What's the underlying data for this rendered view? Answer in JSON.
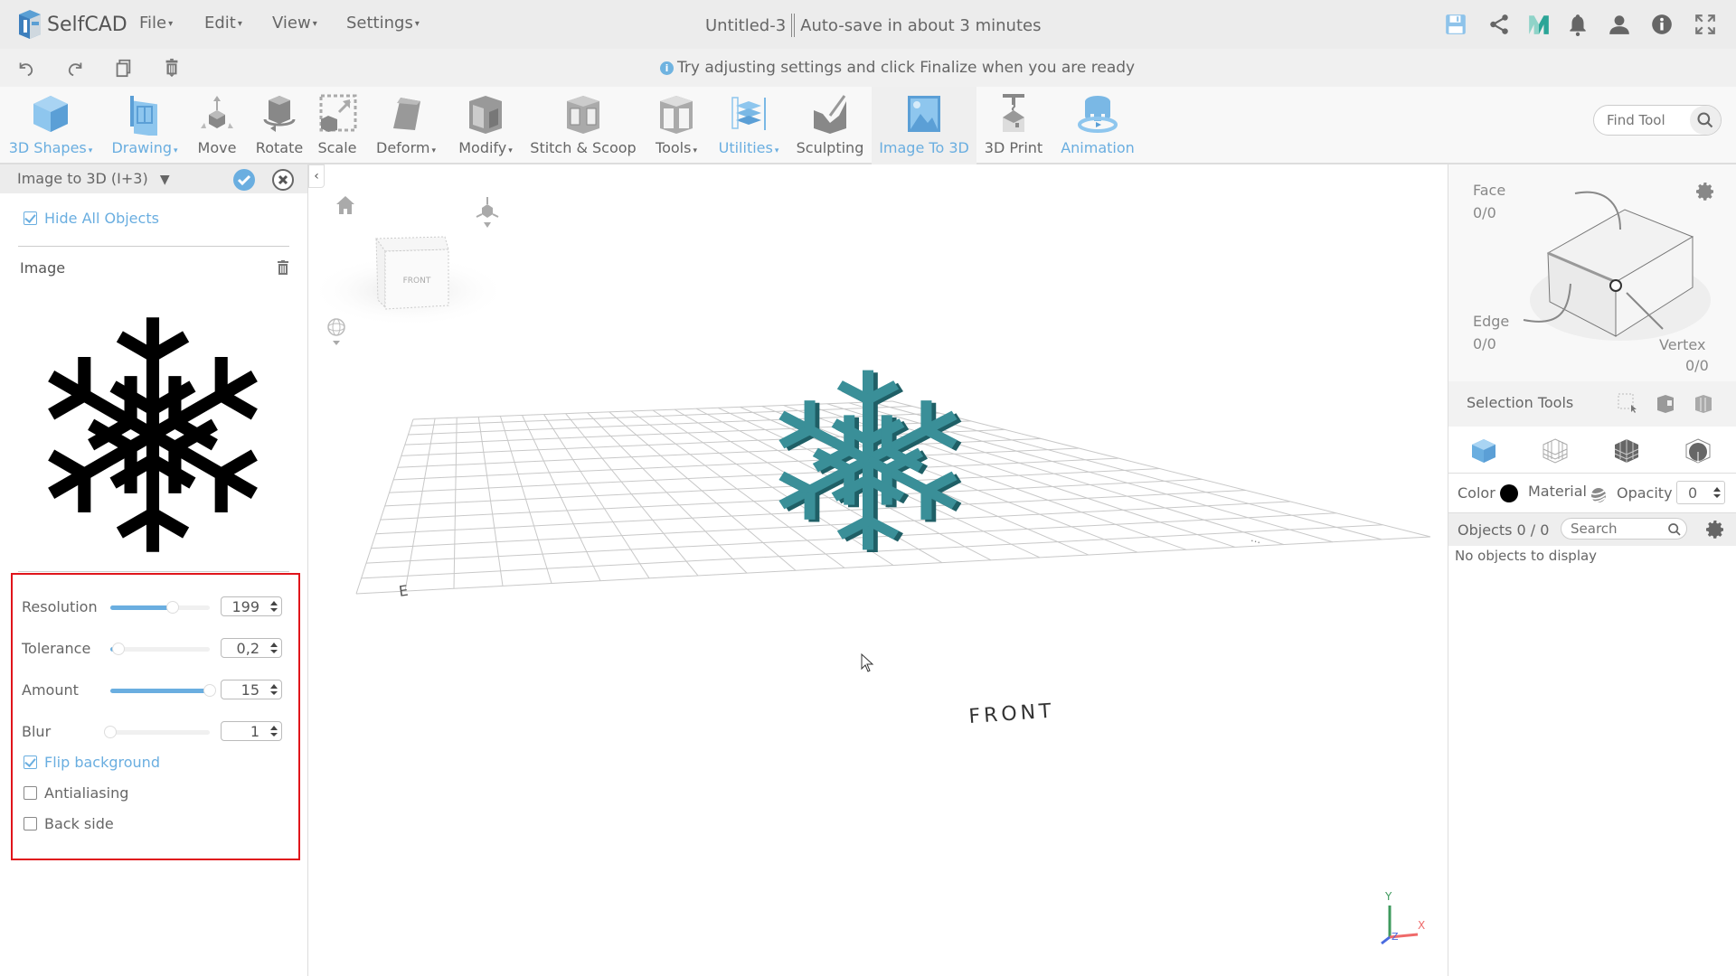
{
  "app": {
    "name": "SelfCAD"
  },
  "menu": [
    {
      "label": "File"
    },
    {
      "label": "Edit"
    },
    {
      "label": "View"
    },
    {
      "label": "Settings"
    }
  ],
  "document": {
    "title": "Untitled-3",
    "autosave": "Auto-save in about 3 minutes"
  },
  "top_icons": [
    "save-icon",
    "share-icon",
    "myminifactory-icon",
    "bell-icon",
    "user-icon",
    "info-icon",
    "fullscreen-icon"
  ],
  "secondary_toolbar": {
    "icons": [
      "undo-icon",
      "redo-icon",
      "copy-icon",
      "trash-icon"
    ],
    "hint": "Try adjusting settings and click Finalize when you are ready"
  },
  "tools": [
    {
      "label": "3D Shapes",
      "dropdown": true,
      "blue": true
    },
    {
      "label": "Drawing",
      "dropdown": true,
      "blue": true
    },
    {
      "label": "Move",
      "dropdown": false
    },
    {
      "label": "Rotate",
      "dropdown": false
    },
    {
      "label": "Scale",
      "dropdown": false
    },
    {
      "label": "Deform",
      "dropdown": true
    },
    {
      "label": "Modify",
      "dropdown": true
    },
    {
      "label": "Stitch & Scoop",
      "dropdown": false
    },
    {
      "label": "Tools",
      "dropdown": true
    },
    {
      "label": "Utilities",
      "dropdown": true,
      "blue": true
    },
    {
      "label": "Sculpting",
      "dropdown": false
    },
    {
      "label": "Image To 3D",
      "dropdown": false,
      "blue": true,
      "active": true
    },
    {
      "label": "3D Print",
      "dropdown": false
    },
    {
      "label": "Animation",
      "dropdown": false,
      "blue": true
    }
  ],
  "find_tool": {
    "placeholder": "Find Tool"
  },
  "left_panel": {
    "title": "Image to 3D (I+3)",
    "hide_all_objects": {
      "label": "Hide All Objects",
      "checked": true
    },
    "image_label": "Image",
    "settings": [
      {
        "label": "Resolution",
        "value": "199",
        "slider_fraction": 0.63
      },
      {
        "label": "Tolerance",
        "value": "0,2",
        "slider_fraction": 0.08
      },
      {
        "label": "Amount",
        "value": "15",
        "slider_fraction": 1.0
      },
      {
        "label": "Blur",
        "value": "1",
        "slider_fraction": 0.0
      }
    ],
    "checkboxes": [
      {
        "label": "Flip background",
        "checked": true
      },
      {
        "label": "Antialiasing",
        "checked": false
      },
      {
        "label": "Back side",
        "checked": false
      }
    ]
  },
  "viewport": {
    "view_cube_label": "FRONT",
    "grid_label": "FRONT",
    "axes": {
      "x": "X",
      "y": "Y",
      "z": "Z"
    },
    "model_color": "#3a8f98"
  },
  "right_panel": {
    "face": {
      "label": "Face",
      "count": "0/0"
    },
    "edge": {
      "label": "Edge",
      "count": "0/0"
    },
    "vertex": {
      "label": "Vertex",
      "count": "0/0"
    },
    "selection_tools": "Selection Tools",
    "color_label": "Color",
    "material_label": "Material",
    "opacity_label": "Opacity",
    "opacity_value": "0",
    "objects_label": "Objects 0 / 0",
    "search_placeholder": "Search",
    "empty": "No objects to display"
  },
  "colors": {
    "accent": "#6aaee0",
    "highlight_border": "#e0141b"
  }
}
